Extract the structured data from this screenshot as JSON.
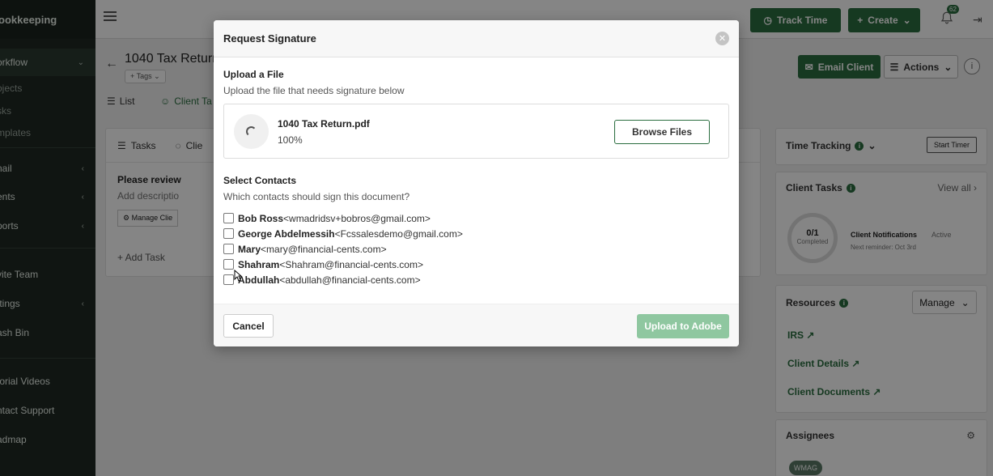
{
  "sidebar": {
    "brand": "ookkeeping",
    "items": [
      {
        "label": "orkflow",
        "chevron": "⌄"
      },
      {
        "label": "ojects"
      },
      {
        "label": "sks"
      },
      {
        "label": "mplates"
      },
      {
        "label": "nail",
        "chevron": "‹"
      },
      {
        "label": "ents",
        "chevron": "‹"
      },
      {
        "label": "ports",
        "chevron": "‹"
      },
      {
        "label": "vite Team"
      },
      {
        "label": "ttings",
        "chevron": "‹"
      },
      {
        "label": "ash Bin"
      },
      {
        "label": "torial Videos"
      },
      {
        "label": "ntact Support"
      },
      {
        "label": "admap"
      }
    ]
  },
  "topbar": {
    "track_time": "Track Time",
    "create": "Create",
    "notifications": "62"
  },
  "page": {
    "title": "1040 Tax Return",
    "tags": "Tags",
    "tabs": [
      "List",
      "Client Ta"
    ],
    "email_client": "Email Client",
    "actions": "Actions"
  },
  "tasks_card": {
    "tabs": [
      "Tasks",
      "Clie"
    ],
    "task_title": "Please review",
    "task_desc": "Add descriptio",
    "manage_client": "Manage Clie",
    "add_task": "+ Add Task"
  },
  "right_panel": {
    "time_tracking": "Time Tracking",
    "start_timer": "Start Timer",
    "client_tasks": "Client Tasks",
    "view_all": "View all",
    "progress": "0/1",
    "completed": "Completed",
    "client_notifications": "Client Notifications",
    "active": "Active",
    "next_reminder": "Next reminder: Oct 3rd",
    "resources": "Resources",
    "manage": "Manage",
    "resource_links": [
      "IRS",
      "Client Details",
      "Client Documents"
    ],
    "assignees": "Assignees",
    "avatar_initials": "WMAG"
  },
  "modal": {
    "title": "Request Signature",
    "upload_title": "Upload a File",
    "upload_sub": "Upload the file that needs signature below",
    "file_name": "1040 Tax Return.pdf",
    "file_progress": "100%",
    "browse_label": "Browse Files",
    "contacts_title": "Select Contacts",
    "contacts_sub": "Which contacts should sign this document?",
    "contacts": [
      {
        "name": "Bob Ross",
        "email": "<wmadridsv+bobros@gmail.com>"
      },
      {
        "name": "George Abdelmessih",
        "email": "<Fcssalesdemo@gmail.com>"
      },
      {
        "name": "Mary",
        "email": "<mary@financial-cents.com>"
      },
      {
        "name": "Shahram",
        "email": "<Shahram@financial-cents.com>"
      },
      {
        "name": "Abdullah",
        "email": "<abdullah@financial-cents.com>"
      }
    ],
    "cancel_label": "Cancel",
    "upload_label": "Upload to Adobe"
  },
  "colors": {
    "brand_green": "#2b6e40",
    "disabled_green": "#8fc7a0"
  }
}
